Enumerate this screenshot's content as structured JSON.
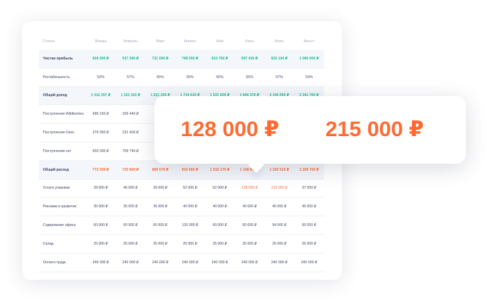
{
  "colors": {
    "positive": "#1bbf8a",
    "negative": "#ff6a33",
    "highlight_row": "#f3f6fb"
  },
  "table": {
    "headers": [
      "Статья",
      "Январь",
      "Февраль",
      "Март",
      "Апрель",
      "Май",
      "Июнь",
      "Июль",
      "Август"
    ],
    "rows": [
      {
        "label": "Чистая прибыль",
        "type": "sum",
        "tone": "green",
        "values": [
          "600 000 ₽",
          "537 390 ₽",
          "731 690 ₽",
          "798 050 ₽",
          "815 750 ₽",
          "697 430 ₽",
          "825 140 ₽",
          "1 080 000 ₽"
        ]
      },
      {
        "label": "Рентабельность",
        "type": "normal",
        "tone": "",
        "values": [
          "53%",
          "57%",
          "55%",
          "55%",
          "55%",
          "55%",
          "57%",
          "54%"
        ]
      },
      {
        "label": "Общий доход",
        "type": "sum",
        "tone": "green",
        "values": [
          "1 416 297 ₽",
          "1 263 160 ₽",
          "1 621 260 ₽",
          "1 714 610 ₽",
          "1 631 839 ₽",
          "1 846 370 ₽",
          "2 145 650 ₽",
          "2 341 760 ₽"
        ]
      },
      {
        "label": "Поступления Wildberries",
        "type": "normal",
        "tone": "",
        "values": [
          "495 150 ₽",
          "326 440 ₽",
          "",
          "",
          "",
          "",
          "",
          ""
        ]
      },
      {
        "label": "Поступления Озон",
        "type": "normal",
        "tone": "",
        "values": [
          "270 050 ₽",
          "231 400 ₽",
          "",
          "",
          "",
          "",
          "",
          ""
        ]
      },
      {
        "label": "Поступления сет",
        "type": "normal",
        "tone": "",
        "values": [
          "603 000 ₽",
          "700 740 ₽",
          "",
          "",
          "",
          "",
          "",
          ""
        ]
      },
      {
        "label": "Общий расход",
        "type": "sum",
        "tone": "orange",
        "values": [
          "772 200 ₽",
          "725 800 ₽",
          "889 570 ₽",
          "916 560 ₽",
          "1 016 170 ₽",
          "1 148 940 ₽",
          "1 320 510 ₽",
          "1 259 760 ₽"
        ]
      },
      {
        "label": "Услуги упаковки",
        "type": "normal",
        "tone": "",
        "values": [
          "28 000 ₽",
          "46 000 ₽",
          "39 000 ₽",
          "52 000 ₽",
          "62 000 ₽",
          "128 000 ₽",
          "215 000 ₽",
          "37 000 ₽"
        ],
        "hot": [
          5,
          6
        ]
      },
      {
        "label": "Реклама и развитие",
        "type": "normal",
        "tone": "",
        "values": [
          "35 000 ₽",
          "35 000 ₽",
          "35 000 ₽",
          "40 000 ₽",
          "40 000 ₽",
          "40 000 ₽",
          "45 000 ₽",
          "45 000 ₽"
        ]
      },
      {
        "label": "Содержание офиса",
        "type": "normal",
        "tone": "",
        "values": [
          "60 000 ₽",
          "60 000 ₽",
          "60 000 ₽",
          "120 000 ₽",
          "60 000 ₽",
          "60 000 ₽",
          "94 000 ₽",
          "60 000 ₽"
        ]
      },
      {
        "label": "Склад",
        "type": "normal",
        "tone": "",
        "values": [
          "25 000 ₽",
          "25 000 ₽",
          "25 000 ₽",
          "25 000 ₽",
          "25 000 ₽",
          "25 000 ₽",
          "25 000 ₽",
          "25 000 ₽"
        ]
      },
      {
        "label": "Оплата труда",
        "type": "normal",
        "tone": "",
        "values": [
          "240 000 ₽",
          "240 000 ₽",
          "240 000 ₽",
          "240 000 ₽",
          "240 000 ₽",
          "240 000 ₽",
          "240 000 ₽",
          "240 000 ₽"
        ]
      }
    ]
  },
  "tooltip": {
    "value_june": "128 000 ₽",
    "value_july": "215 000 ₽"
  }
}
